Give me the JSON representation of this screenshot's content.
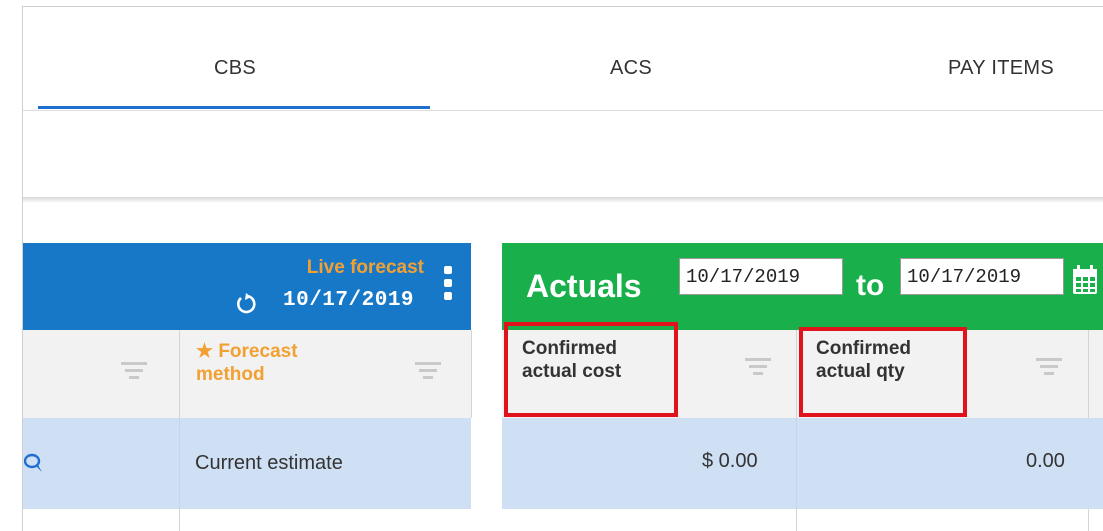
{
  "tabs": [
    {
      "label": "CBS",
      "active": true
    },
    {
      "label": "ACS",
      "active": false
    },
    {
      "label": "PAY ITEMS",
      "active": false
    }
  ],
  "forecast": {
    "title": "Live forecast",
    "date": "10/17/2019",
    "refresh_icon": "refresh-icon",
    "menu_icon": "more-vertical-icon",
    "color": "#1878c8",
    "accent": "#f3a033"
  },
  "actuals": {
    "title": "Actuals",
    "from_date": "10/17/2019",
    "to_label": "to",
    "to_date": "10/17/2019",
    "calendar_icon": "calendar-icon",
    "color": "#19b04b"
  },
  "columns": {
    "forecast_method": {
      "label_line1": "Forecast",
      "label_line2": "method",
      "icon": "star-icon"
    },
    "confirmed_actual_cost": {
      "label_line1": "Confirmed",
      "label_line2": "actual cost"
    },
    "confirmed_actual_qty": {
      "label_line1": "Confirmed",
      "label_line2": "actual qty"
    }
  },
  "row": {
    "comment_icon": "comment-icon",
    "forecast_method": "Current estimate",
    "confirmed_actual_cost": "$ 0.00",
    "confirmed_actual_qty": "0.00"
  },
  "highlight_color": "#e0121c"
}
